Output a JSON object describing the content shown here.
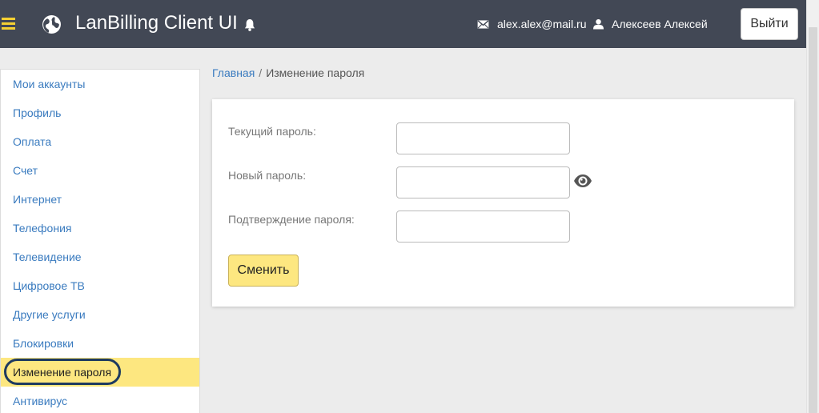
{
  "header": {
    "app_title": "LanBilling Client UI",
    "email": "alex.alex@mail.ru",
    "username": "Алексеев Алексей",
    "logout_label": "Выйти"
  },
  "sidebar": {
    "items": [
      {
        "label": "Мои аккаунты"
      },
      {
        "label": "Профиль"
      },
      {
        "label": "Оплата"
      },
      {
        "label": "Счет"
      },
      {
        "label": "Интернет"
      },
      {
        "label": "Телефония"
      },
      {
        "label": "Телевидение"
      },
      {
        "label": "Цифровое ТВ"
      },
      {
        "label": "Другие услуги"
      },
      {
        "label": "Блокировки"
      },
      {
        "label": "Изменение пароля",
        "active": true
      },
      {
        "label": "Антивирус"
      }
    ]
  },
  "breadcrumb": {
    "home": "Главная",
    "separator": "/",
    "current": "Изменение пароля"
  },
  "form": {
    "current_password_label": "Текущий пароль:",
    "current_password_value": "",
    "new_password_label": "Новый пароль:",
    "new_password_value": "",
    "confirm_password_label": "Подтверждение пароля:",
    "confirm_password_value": "",
    "submit_label": "Сменить"
  },
  "colors": {
    "header_bg": "#424855",
    "accent_yellow": "#fde780",
    "hamburger_yellow": "#f5d033",
    "link_blue": "#3a7bbf",
    "active_ring": "#1e3a5f",
    "page_bg": "#ececec"
  },
  "icons": {
    "menu": "hamburger-icon",
    "logo": "globe-icon",
    "notifications": "bell-icon",
    "email": "envelope-icon",
    "user": "user-icon",
    "show_password": "eye-icon"
  }
}
